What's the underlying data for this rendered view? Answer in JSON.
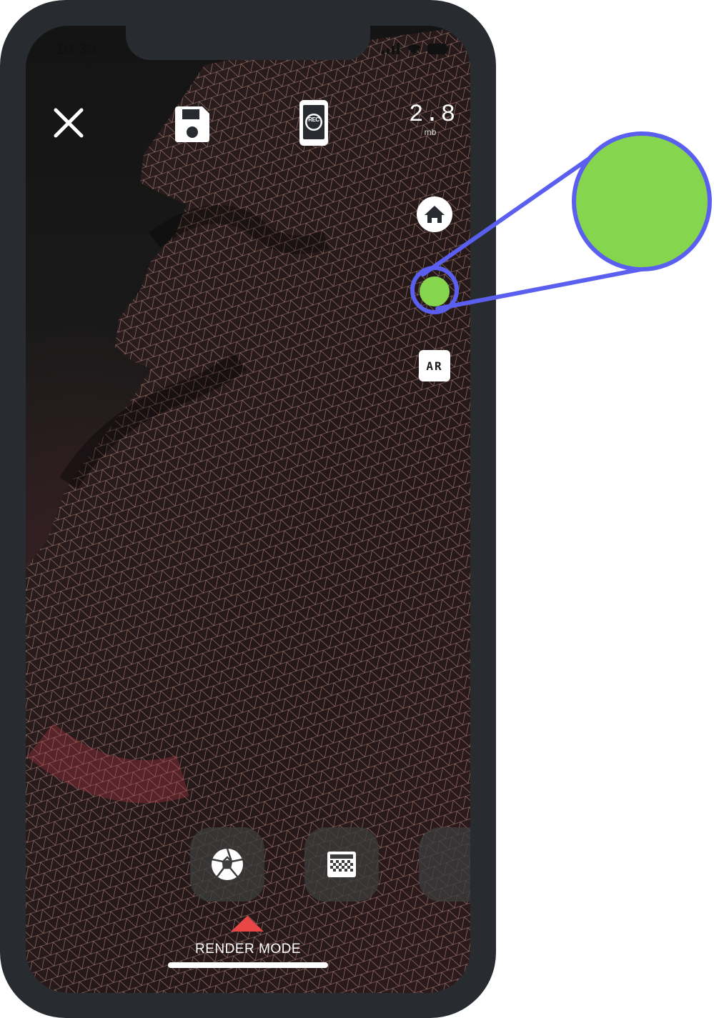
{
  "status_bar": {
    "time": "10:35"
  },
  "top_bar": {
    "close_icon": "close-icon",
    "save_icon": "save-icon",
    "record_icon": "record-icon",
    "record_badge": "REC",
    "file_size_value": "2.8",
    "file_size_unit": "mb"
  },
  "side_bar": {
    "home_icon": "home-icon",
    "highlight_color": "#86d54e",
    "ar_label": "AR"
  },
  "bottom_bar": {
    "modes": [
      {
        "icon": "aperture-icon"
      },
      {
        "icon": "texture-icon"
      }
    ],
    "mode_label": "RENDER MODE",
    "indicator_color": "#e94646"
  },
  "callout": {
    "fill_color": "#86d54e",
    "stroke_color": "#5b5ff0"
  }
}
